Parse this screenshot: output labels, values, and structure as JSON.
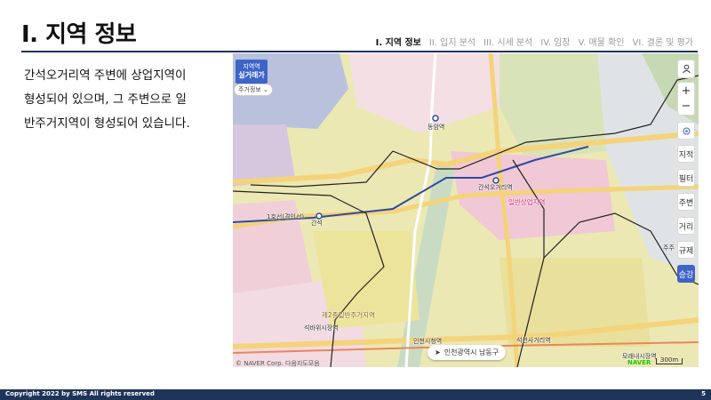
{
  "header": {
    "title": "I. 지역 정보",
    "nav": [
      "I. 지역 정보",
      "II. 입지 분석",
      "III. 시세 분석",
      "IV. 임장",
      "V. 매물 확인",
      "VI. 결론 및 평가"
    ],
    "active_index": 0
  },
  "body": {
    "lines": [
      "간석오거리역 주변에 상업지역이",
      "형성되어 있으며, 그 주변으로 일",
      "반주거지역이 형성되어 있습니다."
    ]
  },
  "map": {
    "badge_top": "지역역",
    "badge_main": "실거래가",
    "chip": "주거정보 ⌄",
    "controls": [
      "지적",
      "필터",
      "주변",
      "거리",
      "규제",
      "승강"
    ],
    "active_control": "승강",
    "address": "인천광역시 남동구",
    "attribution": "© NAVER Corp. 다음지도모음",
    "naver": "NAVER",
    "scale": "300m",
    "labels": {
      "station_top": "동암역",
      "station_mid": "간석오거리역",
      "station_left": "간석",
      "zone_commercial": "일반상업지역",
      "zone_residential": "제2종일반주거지역",
      "market1": "석바위시장역",
      "market2": "인천시청역",
      "market3": "석천사거리역",
      "market4": "모래내시장역",
      "road_left": "1호선(경인선)",
      "right_edge": "주주"
    }
  },
  "footer": {
    "copyright": "Copyright 2022 by SMS  All rights reserved",
    "page": "5"
  }
}
